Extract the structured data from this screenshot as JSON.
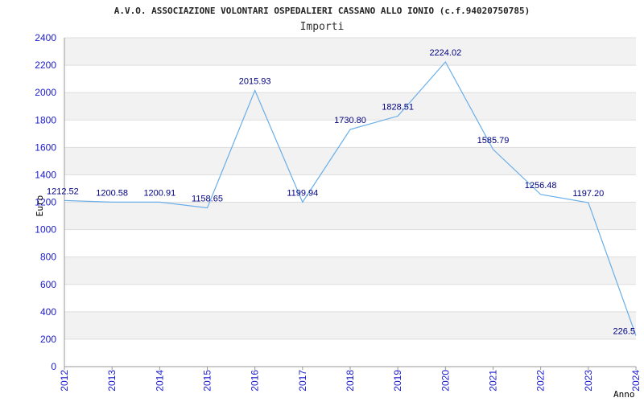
{
  "chart_data": {
    "type": "line",
    "title": "A.V.O. ASSOCIAZIONE VOLONTARI OSPEDALIERI CASSANO ALLO IONIO (c.f.94020750785)",
    "subtitle": "Importi",
    "xlabel": "Anno",
    "ylabel": "Euro",
    "ylim": [
      0,
      2400
    ],
    "yticks": [
      0,
      200,
      400,
      600,
      800,
      1000,
      1200,
      1400,
      1600,
      1800,
      2000,
      2200,
      2400
    ],
    "grid": true,
    "legend": "none",
    "categories": [
      "2012",
      "2013",
      "2014",
      "2015",
      "2016",
      "2017",
      "2018",
      "2019",
      "2020",
      "2021",
      "2022",
      "2023",
      "2024"
    ],
    "values": [
      1212.52,
      1200.58,
      1200.91,
      1158.65,
      2015.93,
      1199.94,
      1730.8,
      1828.51,
      2224.02,
      1585.79,
      1256.48,
      1197.2,
      226.5
    ],
    "value_labels": [
      "1212.52",
      "1200.58",
      "1200.91",
      "1158.65",
      "2015.93",
      "1199.94",
      "1730.80",
      "1828.51",
      "2224.02",
      "1585.79",
      "1256.48",
      "1197.20",
      "226.5"
    ],
    "colors": {
      "line": "#6aaee8",
      "band": "#f2f2f2",
      "grid": "#dddddd",
      "tick_text": "#1a1acc",
      "data_label": "#000080"
    }
  }
}
